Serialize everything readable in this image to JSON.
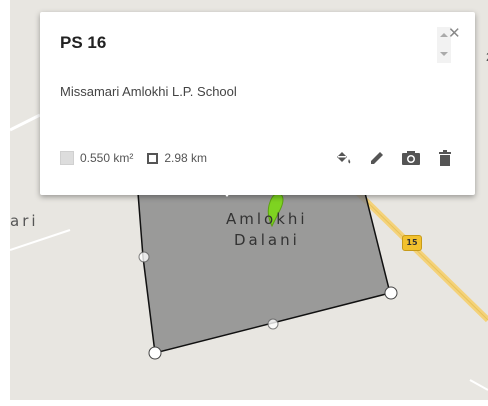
{
  "map": {
    "label_left": "ari",
    "label_name_1": "Amlokhi",
    "label_name_2": "Dalani",
    "road_shield": "15",
    "edge_number": "2",
    "colors": {
      "polygon_fill": "#8c8c8c",
      "road": "#f4d27a",
      "marker": "#7ed321"
    }
  },
  "info_card": {
    "title": "PS 16",
    "description": "Missamari Amlokhi L.P. School",
    "area": "0.550 km²",
    "perimeter": "2.98 km",
    "close_icon": "close-icon",
    "tools": [
      {
        "name": "paint-bucket-icon"
      },
      {
        "name": "pencil-icon"
      },
      {
        "name": "camera-icon"
      },
      {
        "name": "trash-icon"
      }
    ]
  }
}
